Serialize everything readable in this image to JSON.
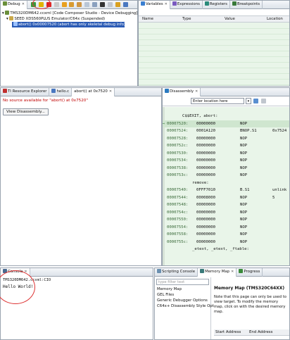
{
  "debug": {
    "tab_label": "Debug",
    "tree": [
      {
        "label": "TMS320DM642.ccxml [Code Composer Studio - Device Debugging]"
      },
      {
        "label": "SEED XDS560PLUS Emulator/C64x (Suspended)"
      },
      {
        "label": "abort() 0x00007520  (abort has only skeletal debug info)"
      }
    ]
  },
  "variables": {
    "tabs": [
      "Variables",
      "Expressions",
      "Registers",
      "Breakpoints"
    ],
    "columns": [
      "Name",
      "Type",
      "Value",
      "Location"
    ]
  },
  "editor": {
    "tabs": [
      "TI Resource Explorer",
      "hello.c",
      "abort() at 0x7520"
    ],
    "message": "No source available for \"abort() at 0x7520\"",
    "button_label": "View Disassembly..."
  },
  "disassembly": {
    "tab_label": "Disassembly",
    "location_placeholder": "Enter location here",
    "rows": [
      {
        "addr": "",
        "code": "C$$EXIT, abort:",
        "op": "",
        "extra": ""
      },
      {
        "addr": "00007520:",
        "code": "00000000",
        "op": "NOP",
        "extra": ""
      },
      {
        "addr": "00007524:",
        "code": "0001A120",
        "op": "BNOP.S1",
        "extra": "0x7524"
      },
      {
        "addr": "00007528:",
        "code": "00000000",
        "op": "NOP",
        "extra": ""
      },
      {
        "addr": "0000752c:",
        "code": "00000000",
        "op": "NOP",
        "extra": ""
      },
      {
        "addr": "00007530:",
        "code": "00000000",
        "op": "NOP",
        "extra": ""
      },
      {
        "addr": "00007534:",
        "code": "00000000",
        "op": "NOP",
        "extra": ""
      },
      {
        "addr": "00007538:",
        "code": "00000000",
        "op": "NOP",
        "extra": ""
      },
      {
        "addr": "0000753c:",
        "code": "00000000",
        "op": "NOP",
        "extra": ""
      },
      {
        "addr": "",
        "code": "remove:",
        "op": "",
        "extra": ""
      },
      {
        "addr": "00007540:",
        "code": "0FFF7010",
        "op": "B.S1",
        "extra": "unlink"
      },
      {
        "addr": "00007544:",
        "code": "00008000",
        "op": "NOP",
        "extra": "5"
      },
      {
        "addr": "00007548:",
        "code": "00000000",
        "op": "NOP",
        "extra": ""
      },
      {
        "addr": "0000754c:",
        "code": "00000000",
        "op": "NOP",
        "extra": ""
      },
      {
        "addr": "00007550:",
        "code": "00000000",
        "op": "NOP",
        "extra": ""
      },
      {
        "addr": "00007554:",
        "code": "00000000",
        "op": "NOP",
        "extra": ""
      },
      {
        "addr": "00007558:",
        "code": "00000000",
        "op": "NOP",
        "extra": ""
      },
      {
        "addr": "0000755c:",
        "code": "00000000",
        "op": "NOP",
        "extra": ""
      },
      {
        "addr": "",
        "code": "_etext, _etext, _ftable:",
        "op": "",
        "extra": ""
      }
    ]
  },
  "console": {
    "tab_label": "Console",
    "title": "TMS320DM642.ccxml:CIO",
    "output": "Hello World!"
  },
  "bottom_right": {
    "tabs": [
      "Scripting Console",
      "Memory Map",
      "Progress"
    ],
    "filter_placeholder": "type filter text",
    "list": [
      "Memory Map",
      "GEL Files",
      "Generic Debugger Options",
      "C64x+ Disassembly Style Opt"
    ],
    "heading": "Memory Map (TMS320C64XX)",
    "note": "Note that this page can only be used to view target. To modify the memory map, click on with the desired memory map.",
    "columns": [
      "Start Address",
      "End Address"
    ]
  }
}
